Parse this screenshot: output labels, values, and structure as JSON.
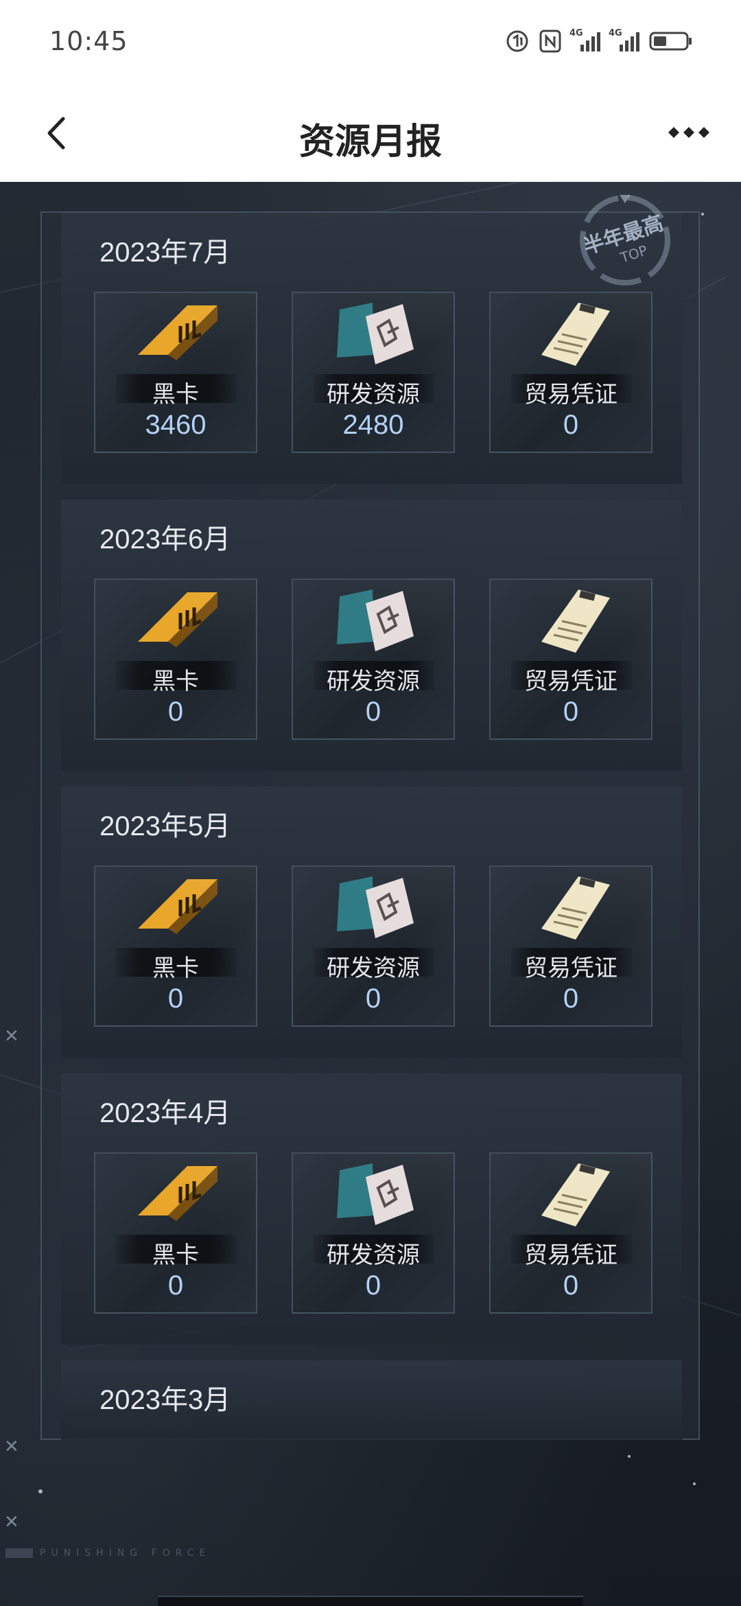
{
  "status_bar": {
    "time": "10:45",
    "network_1": "4G",
    "network_2": "4G"
  },
  "header": {
    "title": "资源月报"
  },
  "badge": {
    "text": "半年最高",
    "sub": "TOP"
  },
  "months": [
    {
      "label": "2023年7月",
      "items": [
        {
          "name": "黑卡",
          "count": "3460",
          "icon": "black-card-icon"
        },
        {
          "name": "研发资源",
          "count": "2480",
          "icon": "research-resource-icon"
        },
        {
          "name": "贸易凭证",
          "count": "0",
          "icon": "trade-voucher-icon"
        }
      ]
    },
    {
      "label": "2023年6月",
      "items": [
        {
          "name": "黑卡",
          "count": "0",
          "icon": "black-card-icon"
        },
        {
          "name": "研发资源",
          "count": "0",
          "icon": "research-resource-icon"
        },
        {
          "name": "贸易凭证",
          "count": "0",
          "icon": "trade-voucher-icon"
        }
      ]
    },
    {
      "label": "2023年5月",
      "items": [
        {
          "name": "黑卡",
          "count": "0",
          "icon": "black-card-icon"
        },
        {
          "name": "研发资源",
          "count": "0",
          "icon": "research-resource-icon"
        },
        {
          "name": "贸易凭证",
          "count": "0",
          "icon": "trade-voucher-icon"
        }
      ]
    },
    {
      "label": "2023年4月",
      "items": [
        {
          "name": "黑卡",
          "count": "0",
          "icon": "black-card-icon"
        },
        {
          "name": "研发资源",
          "count": "0",
          "icon": "research-resource-icon"
        },
        {
          "name": "贸易凭证",
          "count": "0",
          "icon": "trade-voucher-icon"
        }
      ]
    },
    {
      "label": "2023年3月",
      "items": []
    }
  ],
  "footer": {
    "brand": "PUNISHING FORCE"
  },
  "colors": {
    "count_text": "#b4d2f4",
    "gold": "#e8a62a",
    "background": "#1d232b"
  }
}
